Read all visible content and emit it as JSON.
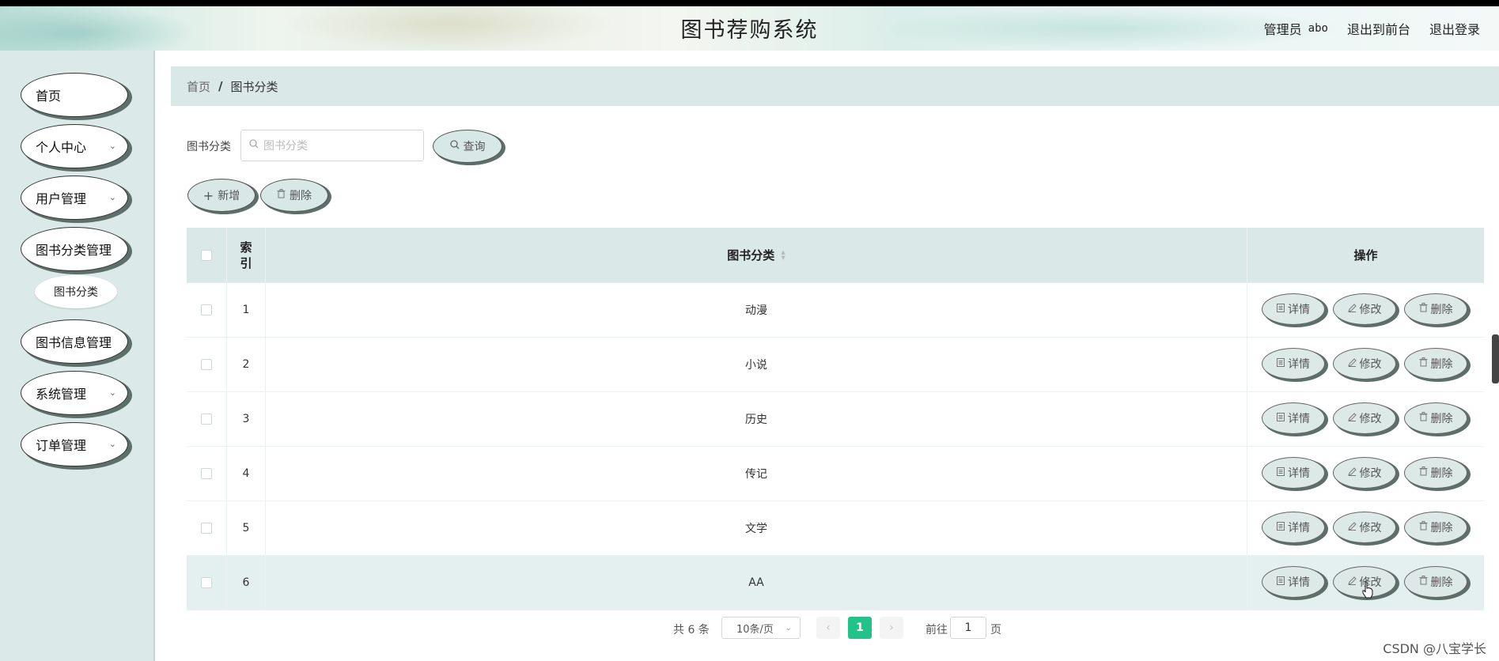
{
  "header": {
    "title": "图书荐购系统",
    "role": "管理员",
    "username": "abo",
    "to_front": "退出到前台",
    "logout": "退出登录"
  },
  "sidebar": {
    "items": [
      {
        "label": "首页",
        "expandable": false
      },
      {
        "label": "个人中心",
        "expandable": true
      },
      {
        "label": "用户管理",
        "expandable": true
      },
      {
        "label": "图书分类管理",
        "expandable": false
      },
      {
        "label": "图书信息管理",
        "expandable": false
      },
      {
        "label": "系统管理",
        "expandable": true
      },
      {
        "label": "订单管理",
        "expandable": true
      }
    ],
    "sub_item": "图书分类"
  },
  "breadcrumb": {
    "home": "首页",
    "separator": "/",
    "current": "图书分类"
  },
  "search": {
    "label": "图书分类",
    "placeholder": "图书分类",
    "button": "查询"
  },
  "toolbar": {
    "add": "新增",
    "delete": "删除"
  },
  "table": {
    "columns": {
      "index": "索\n引",
      "name": "图书分类",
      "ops": "操作"
    },
    "rows": [
      {
        "index": "1",
        "name": "动漫"
      },
      {
        "index": "2",
        "name": "小说"
      },
      {
        "index": "3",
        "name": "历史"
      },
      {
        "index": "4",
        "name": "传记"
      },
      {
        "index": "5",
        "name": "文学"
      },
      {
        "index": "6",
        "name": "AA"
      }
    ],
    "row_actions": {
      "detail": "详情",
      "edit": "修改",
      "delete": "删除"
    }
  },
  "pagination": {
    "total_prefix": "共",
    "total": "6",
    "total_suffix": "条",
    "page_size": "10条/页",
    "current_page": "1",
    "goto_label": "前往",
    "goto_value": "1",
    "page_suffix": "页"
  },
  "watermark": "CSDN @八宝学长",
  "colors": {
    "sidebar_bg": "#dbe9e9",
    "breadcrumb_bg": "#dae9e8",
    "button_bg": "#d8e8e6",
    "page_active": "#23c28a"
  },
  "icons": [
    "search-icon",
    "plus-icon",
    "trash-icon",
    "document-icon",
    "pencil-icon",
    "chevron-down-icon",
    "chevron-left-icon",
    "chevron-right-icon",
    "sort-icon",
    "hand-cursor-icon"
  ]
}
